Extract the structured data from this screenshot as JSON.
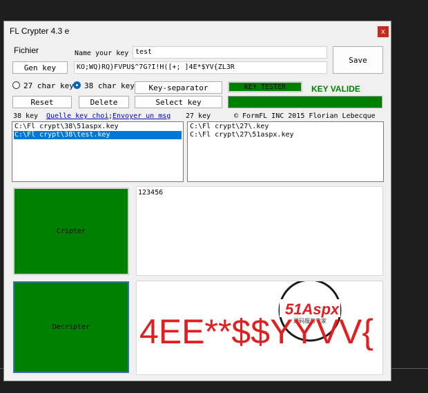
{
  "window": {
    "title": "FL Crypter 4.3 e",
    "close_glyph": "x"
  },
  "menu": {
    "fichier": "Fichier"
  },
  "key_name": {
    "label": "Name your key",
    "value": "test"
  },
  "key_value": {
    "value": "KO;WQ)RQ}FVPU$^7G?I!H([+; ]4E*$YV{ZL3R"
  },
  "buttons": {
    "save": "Save",
    "gen_key": "Gen key",
    "key_separator": "Key-separator",
    "reset": "Reset",
    "delete": "Delete",
    "select_key": "Select key",
    "key_tester": "KEY TESTER",
    "cripter": "Cripter",
    "decripter": "Decripter"
  },
  "radio": {
    "opt27": "27 char key",
    "opt38": "38 char key",
    "selected": "38 char key"
  },
  "status": {
    "key_valid": "KEY VALIDE",
    "key_valid_color": "#008000"
  },
  "lists": {
    "left_header": "38 key",
    "link1": "Quelle key choi",
    "link_sep": ";",
    "link2": "Envoyer un msg",
    "left_items": [
      "C:\\Fl crypt\\38\\51aspx.key",
      "C:\\Fl crypt\\38\\test.key"
    ],
    "right_header": "27 key",
    "copyright": "© FormFL INC 2015 Florian Lebecque",
    "right_items": [
      "C:\\Fl crypt\\27\\.key",
      "C:\\Fl crypt\\27\\51aspx.key"
    ]
  },
  "input_text": "123456",
  "output_text": "4EE**$$YYVV{",
  "watermark": {
    "brand": "51Aspx",
    "sub": "源码服务专家"
  },
  "colors": {
    "accent_green": "#008000",
    "selection_blue": "#0078d7",
    "close_red": "#c42b1c",
    "output_red": "#e02020"
  }
}
